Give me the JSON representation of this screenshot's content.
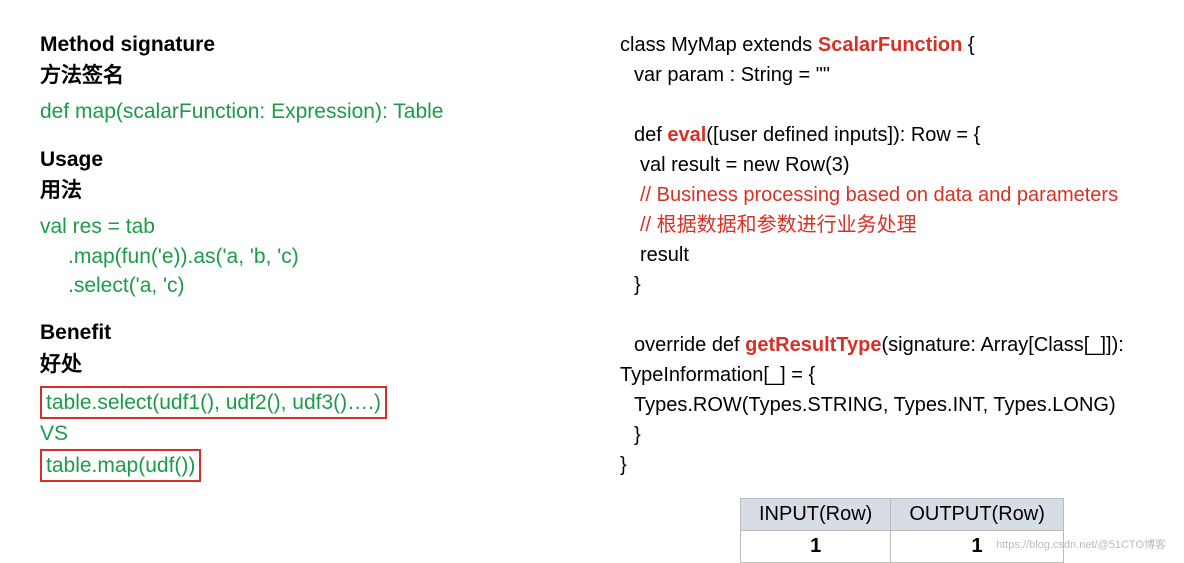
{
  "left": {
    "method_sig_heading_en": "Method signature",
    "method_sig_heading_cn": "方法签名",
    "method_sig_code": "def map(scalarFunction: Expression): Table",
    "usage_heading_en": "Usage",
    "usage_heading_cn": "用法",
    "usage_code_line1": "val res = tab",
    "usage_code_line2": ".map(fun('e)).as('a, 'b, 'c)",
    "usage_code_line3": ".select('a, 'c)",
    "benefit_heading_en": "Benefit",
    "benefit_heading_cn": "好处",
    "benefit_box1": "table.select(udf1(), udf2(), udf3()….)",
    "benefit_vs": "VS",
    "benefit_box2": "table.map(udf())"
  },
  "right": {
    "line1_pre": "class MyMap extends ",
    "line1_bold": "ScalarFunction",
    "line1_post": " {",
    "line2": "var param : String = \"\"",
    "line_blank": "",
    "line3_pre": "def ",
    "line3_bold": "eval",
    "line3_post": "([user defined inputs]): Row = {",
    "line4": "val result = new Row(3)",
    "line5": "// Business processing based on data and parameters",
    "line6": "// 根据数据和参数进行业务处理",
    "line7": "result",
    "line8": "}",
    "line9_pre": "override def ",
    "line9_bold": "getResultType",
    "line9_post": "(signature: Array[Class[_]]):",
    "line10": "TypeInformation[_] = {",
    "line11": "Types.ROW(Types.STRING, Types.INT, Types.LONG)",
    "line12": "}",
    "line13": "}",
    "table": {
      "h1": "INPUT(Row)",
      "h2": "OUTPUT(Row)",
      "v1": "1",
      "v2": "1"
    }
  },
  "watermark": "https://blog.csdn.net/@51CTO博客"
}
